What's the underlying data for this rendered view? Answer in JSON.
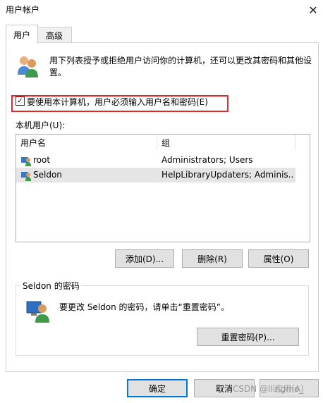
{
  "window": {
    "title": "用户帐户",
    "close_glyph": "✕"
  },
  "tabs": [
    {
      "label": "用户"
    },
    {
      "label": "高级"
    }
  ],
  "description": "用下列表授予或拒绝用户访问你的计算机，还可以更改其密码和其他设置。",
  "require_password": {
    "label": "要使用本计算机，用户必须输入用户名和密码(E)",
    "checked": true,
    "check_glyph": "✓"
  },
  "users_section": {
    "label": "本机用户(U):",
    "columns": [
      "用户名",
      "组"
    ],
    "rows": [
      {
        "name": "root",
        "group": "Administrators; Users"
      },
      {
        "name": "Seldon",
        "group": "HelpLibraryUpdaters; Adminis..."
      }
    ]
  },
  "buttons": {
    "add": "添加(D)...",
    "remove": "删除(R)",
    "properties": "属性(O)",
    "reset_password": "重置密码(P)...",
    "ok": "确定",
    "cancel": "取消",
    "apply": "应用(A)"
  },
  "password_group": {
    "title": "Seldon 的密码",
    "text": "要更改 Seldon 的密码，请单击“重置密码”。"
  },
  "watermark": "CSDN @llingmo_",
  "colors": {
    "highlight_border": "#e02a2a",
    "default_button_border": "#0078d7"
  }
}
